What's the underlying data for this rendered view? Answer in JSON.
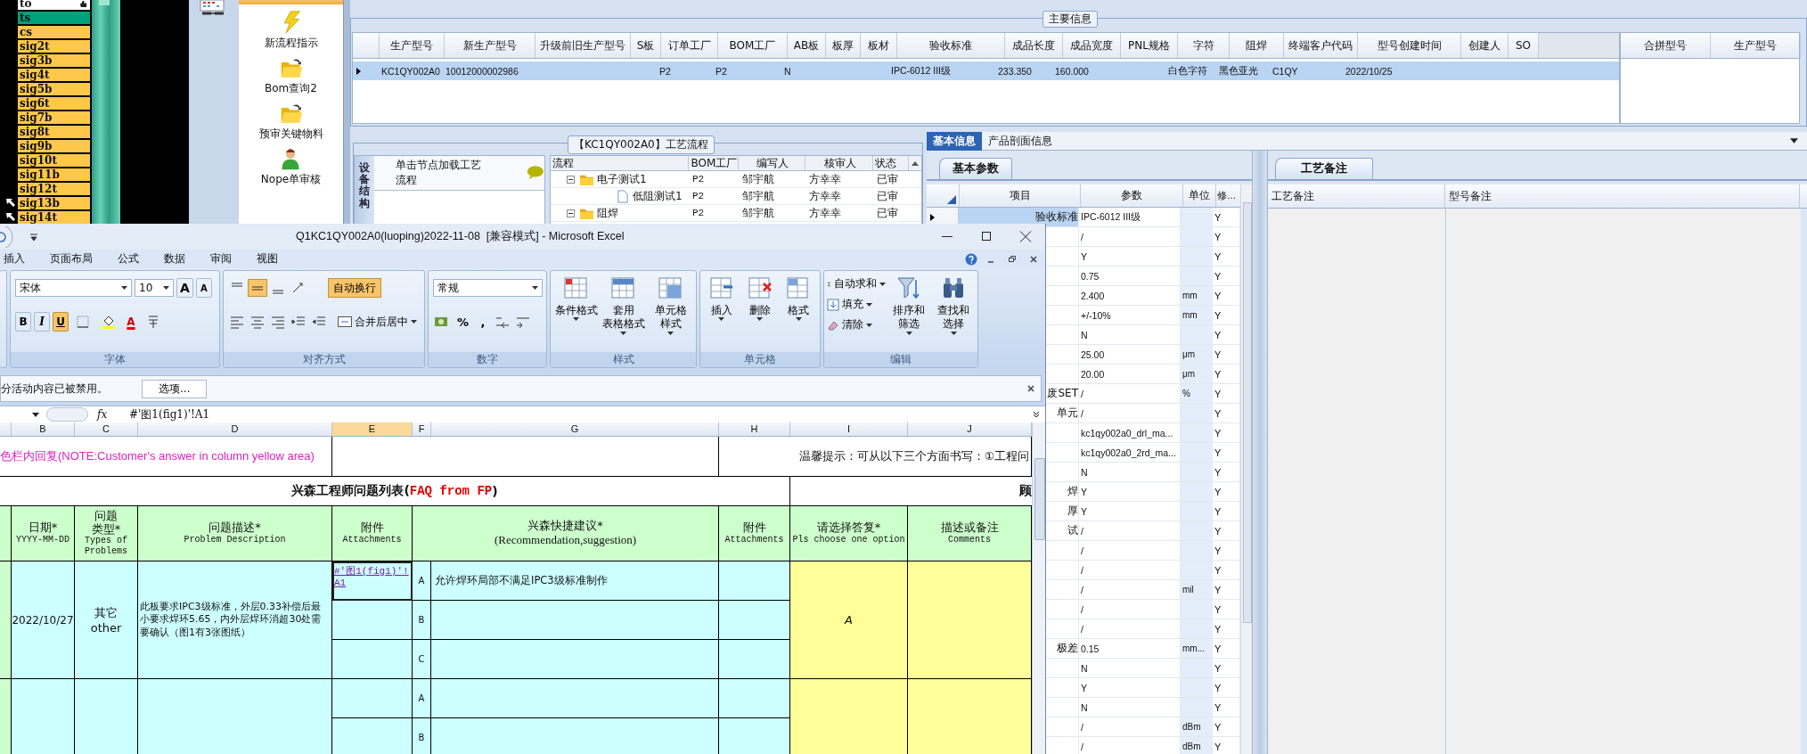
{
  "signal_list": {
    "items": [
      {
        "label": "to",
        "kind": "input",
        "color": "#ffffff"
      },
      {
        "label": "ts",
        "kind": "item",
        "color": "#00a27a"
      },
      {
        "label": "cs",
        "kind": "item",
        "color": "#ffc84a"
      },
      {
        "label": "sig2t",
        "kind": "item",
        "color": "#ffc84a"
      },
      {
        "label": "sig3b",
        "kind": "item",
        "color": "#ffc84a"
      },
      {
        "label": "sig4t",
        "kind": "item",
        "color": "#ffc84a"
      },
      {
        "label": "sig5b",
        "kind": "item",
        "color": "#ffc84a"
      },
      {
        "label": "sig6t",
        "kind": "item",
        "color": "#ffc84a"
      },
      {
        "label": "sig7b",
        "kind": "item",
        "color": "#ffc84a"
      },
      {
        "label": "sig8t",
        "kind": "item",
        "color": "#ffc84a"
      },
      {
        "label": "sig9b",
        "kind": "item",
        "color": "#ffc84a"
      },
      {
        "label": "sig10t",
        "kind": "item",
        "color": "#ffc84a"
      },
      {
        "label": "sig11b",
        "kind": "item",
        "color": "#ffc84a"
      },
      {
        "label": "sig12t",
        "kind": "item",
        "color": "#ffc84a"
      },
      {
        "label": "sig13b",
        "kind": "flagged",
        "color": "#ffc84a"
      },
      {
        "label": "sig14t",
        "kind": "flagged",
        "color": "#ffc84a"
      }
    ]
  },
  "sidebar": {
    "items": [
      "新流程指示",
      "Bom查询2",
      "预审关键物料",
      "Nope单审核"
    ]
  },
  "main_info": {
    "title": "主要信息",
    "columns": [
      "生产型号",
      "新生产型号",
      "升级前旧生产型号",
      "S板",
      "订单工厂",
      "BOM工厂",
      "AB板",
      "板厚",
      "板材",
      "验收标准",
      "成品长度",
      "成品宽度",
      "PNL规格",
      "字符",
      "阻焊",
      "终端客户代码",
      "型号创建时间",
      "创建人",
      "SO"
    ],
    "rows": [
      {
        "selected": true,
        "cells": [
          "KC1QY002A0",
          "10012000002986",
          null,
          null,
          "P2",
          "P2",
          "N",
          null,
          null,
          "IPC-6012 III级",
          "233.350",
          "160.000",
          null,
          "白色字符",
          "黑色亚光",
          "C1QY",
          "2022/10/25",
          null,
          null
        ]
      }
    ],
    "side_columns": [
      "合拼型号",
      "生产型号"
    ]
  },
  "process_flow": {
    "title": "【KC1QY002A0】工艺流程",
    "side_tab": "设备结构",
    "hint": "单击节点加载工艺流程",
    "columns": [
      "流程",
      "BOM工厂",
      "编写人",
      "核审人",
      "状态"
    ],
    "rows": [
      {
        "name": "电子测试1",
        "kind": "folder",
        "expanded": true,
        "bom_factory": "P2",
        "writer": "邹宇航",
        "reviewer": "方幸幸",
        "status": "已审",
        "children": [
          {
            "name": "低阻测试1",
            "kind": "file",
            "bom_factory": "P2",
            "writer": "邹宇航",
            "reviewer": "方幸幸",
            "status": "已审"
          }
        ]
      },
      {
        "name": "阻焊",
        "kind": "folder",
        "expanded": true,
        "bom_factory": "P2",
        "writer": "邹宇航",
        "reviewer": "方幸幸",
        "status": "已审"
      }
    ]
  },
  "info_panel": {
    "tabs": [
      {
        "label": "基本信息",
        "selected": true
      },
      {
        "label": "产品剖面信息",
        "selected": false
      }
    ],
    "sub_tab": "基本参数",
    "columns": [
      "项目",
      "参数",
      "单位",
      "修..."
    ],
    "rows": [
      {
        "item": "验收标准",
        "value": "IPC-6012 III级",
        "flag": "Y",
        "selected": true
      },
      {
        "value": "/",
        "flag": "Y",
        "selected": false
      },
      {
        "value": "Y",
        "flag": "Y",
        "selected": false
      },
      {
        "value": "0.75",
        "flag": "Y",
        "selected": false
      },
      {
        "value": "2.400",
        "unit": "mm",
        "flag": "Y",
        "selected": false
      },
      {
        "value": "+/-10%",
        "unit": "mm",
        "flag": "Y",
        "selected": false
      },
      {
        "value": "N",
        "flag": "Y",
        "selected": false
      },
      {
        "value": "25.00",
        "unit": "μm",
        "flag": "Y",
        "selected": false
      },
      {
        "value": "20.00",
        "unit": "μm",
        "flag": "Y",
        "selected": false
      },
      {
        "item": "废SET",
        "value": "/",
        "unit": "%",
        "flag": "Y",
        "selected": false
      },
      {
        "item": "单元",
        "value": "/",
        "flag": "Y",
        "selected": false
      },
      {
        "value": "kc1qy002a0_drl_ma...",
        "flag": "Y",
        "selected": false
      },
      {
        "value": "kc1qy002a0_2rd_ma...",
        "flag": "Y",
        "selected": false
      },
      {
        "value": "N",
        "flag": "Y",
        "selected": false
      },
      {
        "item": "焊",
        "value": "Y",
        "flag": "Y",
        "selected": false
      },
      {
        "item": "厚",
        "value": "Y",
        "flag": "Y",
        "selected": false
      },
      {
        "item": "试",
        "value": "/",
        "flag": "Y",
        "selected": false
      },
      {
        "value": "/",
        "flag": "Y",
        "selected": false
      },
      {
        "value": "/",
        "flag": "Y",
        "selected": false
      },
      {
        "value": "/",
        "unit": "mil",
        "flag": "Y",
        "selected": false
      },
      {
        "value": "/",
        "flag": "Y",
        "selected": false
      },
      {
        "value": "/",
        "flag": "Y",
        "selected": false
      },
      {
        "item": "极差",
        "value": "0.15",
        "unit": "mm...",
        "flag": "Y",
        "selected": false
      },
      {
        "value": "N",
        "flag": "Y",
        "selected": false
      },
      {
        "value": "Y",
        "flag": "Y",
        "selected": false
      },
      {
        "value": "N",
        "flag": "Y",
        "selected": false
      },
      {
        "value": "/",
        "unit": "dBm",
        "flag": "Y",
        "selected": false
      },
      {
        "value": "/",
        "unit": "dBm",
        "flag": "Y",
        "selected": false
      }
    ]
  },
  "notes_panel": {
    "tab": "工艺备注",
    "columns": [
      "工艺备注",
      "型号备注"
    ]
  },
  "excel": {
    "title": "Q1KC1QY002A0(luoping)2022-11-08  [兼容模式] - Microsoft Excel",
    "menu_tabs": [
      "插入",
      "页面布局",
      "公式",
      "数据",
      "审阅",
      "视图"
    ],
    "ribbon": {
      "font_name": "宋体",
      "font_size": "10",
      "grow_font": "A",
      "shrink_font": "A",
      "font_color": "A",
      "format_buttons": [
        {
          "label": "B",
          "selected": false
        },
        {
          "label": "I",
          "selected": false
        },
        {
          "label": "U",
          "selected": true
        }
      ],
      "vertical_align": [
        {
          "selected": false
        },
        {
          "selected": true
        },
        {
          "selected": false
        }
      ],
      "wrap_text": {
        "label": "自动换行",
        "selected": true
      },
      "merge": "合并后居中",
      "number_format": "常规",
      "percent": "%",
      "comma": ",",
      "style_buttons": [
        [
          "条件格式"
        ],
        [
          "套用",
          "表格格式"
        ],
        [
          "单元格",
          "样式"
        ]
      ],
      "cell_buttons": [
        "插入",
        "删除",
        "格式"
      ],
      "edit_small": [
        "自动求和",
        "填充",
        "清除"
      ],
      "edit_large": [
        [
          "排序和",
          "筛选"
        ],
        [
          "查找和",
          "选择"
        ]
      ],
      "groups": [
        "字体",
        "对齐方式",
        "数字",
        "样式",
        "单元格",
        "编辑"
      ]
    },
    "message_bar": {
      "text": "分活动内容已被禁用。",
      "button": "选项..."
    },
    "formula_bar": {
      "fx": "fx",
      "value": "#'图1(fig1)'!A1"
    },
    "columns": [
      {
        "label": "B",
        "selected": false
      },
      {
        "label": "C",
        "selected": false
      },
      {
        "label": "D",
        "selected": false
      },
      {
        "label": "E",
        "selected": true
      },
      {
        "label": "F",
        "selected": false
      },
      {
        "label": "G",
        "selected": false
      },
      {
        "label": "H",
        "selected": false
      },
      {
        "label": "I",
        "selected": false
      },
      {
        "label": "J",
        "selected": false
      }
    ],
    "sheet": {
      "note": "色栏内回复(NOTE:Customer's answer in column yellow area)",
      "tip": "温馨提示：可从以下三个方面书写：①工程问",
      "heading": "兴森工程师问题列表(",
      "heading_tag": "FAQ from FP",
      "heading_end": ")",
      "customer_heading": "顾",
      "headers": [
        {
          "title": [
            "日期*"
          ],
          "subtitle": "YYYY-MM-DD"
        },
        {
          "title": [
            "问题",
            "类型*"
          ],
          "subtitle": "Types of Problems"
        },
        {
          "title": [
            "问题描述*"
          ],
          "subtitle": "Problem Description"
        },
        {
          "title": [
            "附件"
          ],
          "subtitle": "Attachments"
        },
        {
          "title": [
            "兴森快捷建议*"
          ],
          "subtitle": "(Recommendation,suggestion)"
        },
        {
          "title": [
            "附件"
          ],
          "subtitle": "Attachments"
        },
        {
          "title": [
            "请选择答复*"
          ],
          "subtitle": "Pls choose one option"
        },
        {
          "title": [
            "描述或备注"
          ],
          "subtitle": "Comments"
        }
      ],
      "groups": [
        {
          "date": "2022/10/27",
          "type": [
            "其它",
            "other"
          ],
          "description": "此板要求IPC3级标准，外层0.33补偿后最小要求焊环5.65，内外层焊环消超30处需要确认（图1有3张图纸）",
          "answer": "A",
          "options": [
            {
              "letter": "A",
              "attachment": "#'图1(fig1)'!A1",
              "suggestion": "允许焊环局部不满足IPC3级标准制作"
            },
            {
              "letter": "B"
            },
            {
              "letter": "C"
            }
          ]
        },
        {
          "options": [
            {
              "letter": "A"
            },
            {
              "letter": "B"
            }
          ]
        }
      ]
    }
  }
}
